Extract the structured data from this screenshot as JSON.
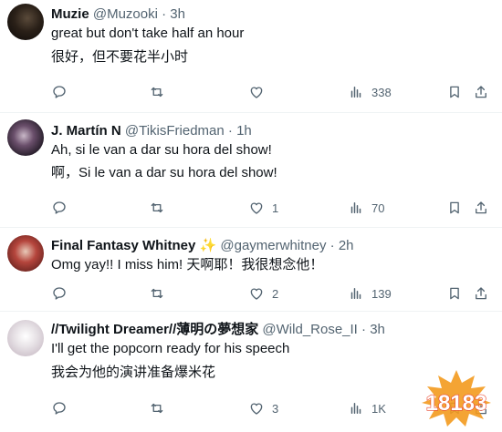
{
  "tweets": [
    {
      "name": "Muzie",
      "handle": "@Muzooki",
      "dot": "·",
      "time": "3h",
      "lines": [
        "great but don't take half an hour",
        "很好，但不要花半小时"
      ],
      "replies": "",
      "retweets": "",
      "likes": "",
      "views": "338"
    },
    {
      "name": "J. Martín N",
      "handle": "@TikisFriedman",
      "dot": "·",
      "time": "1h",
      "lines": [
        "Ah, si le van a dar su hora del show!",
        "啊，Si le van a dar su hora del show!"
      ],
      "replies": "",
      "retweets": "",
      "likes": "1",
      "views": "70"
    },
    {
      "name": "Final Fantasy Whitney ✨",
      "handle": "@gaymerwhitney",
      "dot": "·",
      "time": "2h",
      "lines": [
        "Omg yay!! I miss him! 天啊耶！我很想念他！"
      ],
      "replies": "",
      "retweets": "",
      "likes": "2",
      "views": "139"
    },
    {
      "name": "//Twilight Dreamer//薄明の夢想家",
      "handle": "@Wild_Rose_II",
      "dot": "·",
      "time": "3h",
      "lines": [
        "I'll get the popcorn ready for his speech",
        "我会为他的演讲准备爆米花"
      ],
      "replies": "",
      "retweets": "",
      "likes": "3",
      "views": "1K"
    }
  ],
  "icons": {
    "reply": "reply-icon",
    "retweet": "retweet-icon",
    "like": "like-icon",
    "views": "views-icon",
    "bookmark": "bookmark-icon",
    "share": "share-icon"
  },
  "watermark": {
    "text": "18183"
  },
  "colors": {
    "text": "#0f1419",
    "muted": "#536471",
    "divider": "#eff3f4",
    "watermark_orange": "#f39a1e",
    "watermark_red": "#e8452c"
  }
}
